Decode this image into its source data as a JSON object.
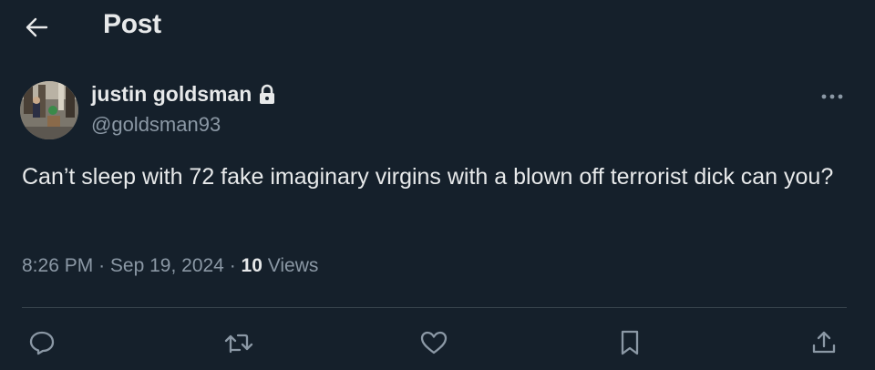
{
  "header": {
    "title": "Post",
    "back_icon": "arrow-left-icon"
  },
  "author": {
    "display_name": "justin goldsman",
    "handle": "@goldsman93",
    "protected_icon": "lock-icon",
    "avatar_icon": "avatar"
  },
  "tweet": {
    "text": "Can’t sleep with 72 fake imaginary virgins with a blown off terrorist dick can you?"
  },
  "meta": {
    "time": "8:26 PM",
    "separator": "·",
    "date": "Sep 19, 2024",
    "views_count": "10",
    "views_label": "Views"
  },
  "actions": [
    {
      "name": "reply",
      "icon": "reply-icon"
    },
    {
      "name": "repost",
      "icon": "repost-icon"
    },
    {
      "name": "like",
      "icon": "heart-icon"
    },
    {
      "name": "bookmark",
      "icon": "bookmark-icon"
    },
    {
      "name": "share",
      "icon": "share-icon"
    }
  ],
  "colors": {
    "background": "#15202b",
    "primary_text": "#e7e9ea",
    "secondary_text": "#8b98a5",
    "divider": "#38444d"
  }
}
